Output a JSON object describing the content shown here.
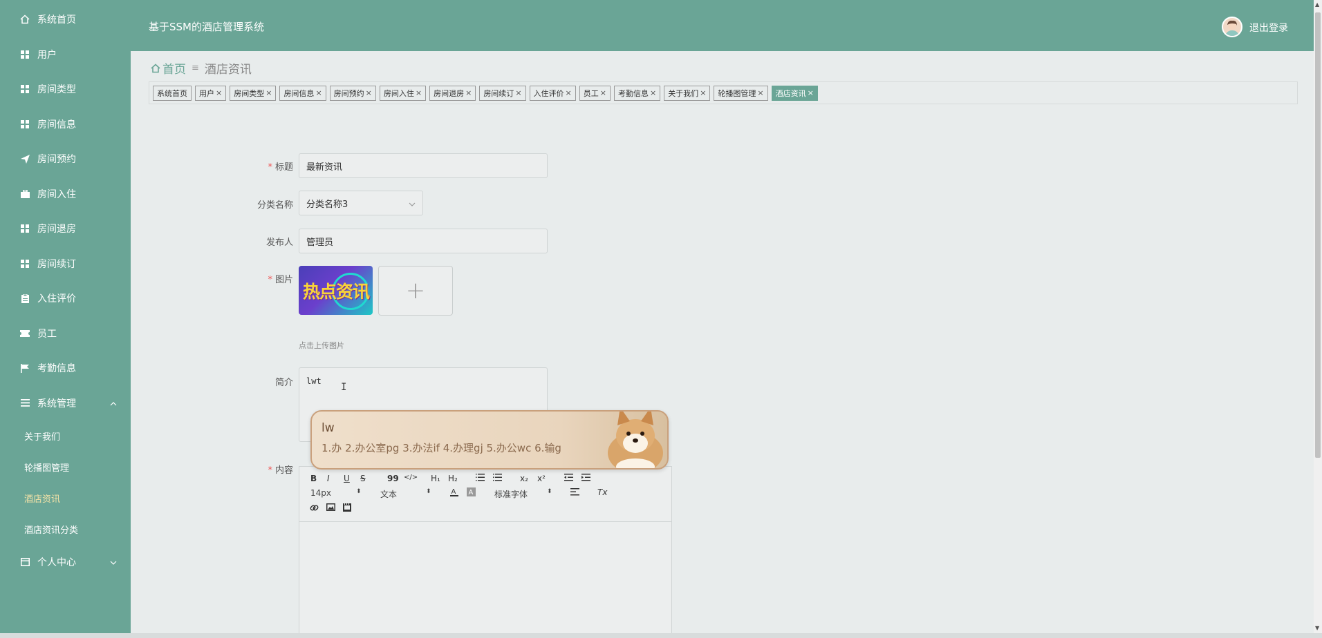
{
  "header": {
    "title": "基于SSM的酒店管理系统",
    "logout": "退出登录"
  },
  "sidebar": {
    "items": [
      {
        "label": "系统首页",
        "icon": "home-icon"
      },
      {
        "label": "用户",
        "icon": "grid-icon"
      },
      {
        "label": "房间类型",
        "icon": "grid-icon"
      },
      {
        "label": "房间信息",
        "icon": "grid-icon"
      },
      {
        "label": "房间预约",
        "icon": "send-icon"
      },
      {
        "label": "房间入住",
        "icon": "briefcase-icon"
      },
      {
        "label": "房间退房",
        "icon": "grid-icon"
      },
      {
        "label": "房间续订",
        "icon": "grid-icon"
      },
      {
        "label": "入住评价",
        "icon": "clipboard-icon"
      },
      {
        "label": "员工",
        "icon": "ticket-icon"
      },
      {
        "label": "考勤信息",
        "icon": "flag-icon"
      },
      {
        "label": "系统管理",
        "icon": "list-icon"
      }
    ],
    "system_sub": [
      "关于我们",
      "轮播图管理",
      "酒店资讯",
      "酒店资讯分类"
    ],
    "personal": {
      "label": "个人中心",
      "icon": "calendar-icon"
    }
  },
  "breadcrumb": {
    "home": "首页",
    "current": "酒店资讯"
  },
  "tags": [
    {
      "label": "系统首页",
      "closable": false
    },
    {
      "label": "用户",
      "closable": true
    },
    {
      "label": "房间类型",
      "closable": true
    },
    {
      "label": "房间信息",
      "closable": true
    },
    {
      "label": "房间预约",
      "closable": true
    },
    {
      "label": "房间入住",
      "closable": true
    },
    {
      "label": "房间退房",
      "closable": true
    },
    {
      "label": "房间续订",
      "closable": true
    },
    {
      "label": "入住评价",
      "closable": true
    },
    {
      "label": "员工",
      "closable": true
    },
    {
      "label": "考勤信息",
      "closable": true
    },
    {
      "label": "关于我们",
      "closable": true
    },
    {
      "label": "轮播图管理",
      "closable": true
    },
    {
      "label": "酒店资讯",
      "closable": true,
      "active": true
    }
  ],
  "form": {
    "title_label": "标题",
    "title_value": "最新资讯",
    "category_label": "分类名称",
    "category_value": "分类名称3",
    "publisher_label": "发布人",
    "publisher_value": "管理员",
    "image_label": "图片",
    "image_text": "热点资讯",
    "upload_hint": "点击上传图片",
    "intro_label": "简介",
    "intro_value": "lwt",
    "content_label": "内容"
  },
  "ime": {
    "composition": "lw",
    "candidates": "1.办  2.办公室pg  3.办法if  4.办理gj  5.办公wc  6.输g"
  },
  "editor": {
    "font_size": "14px",
    "paragraph": "文本",
    "font_family": "标准字体",
    "buttons": {
      "bold": "B",
      "italic": "I",
      "underline": "U",
      "strike": "S",
      "quote": "99",
      "code": "</>",
      "h1": "H₁",
      "h2": "H₂",
      "sub": "x₂",
      "sup": "x²",
      "clear": "Tx"
    }
  },
  "required_mark": "*",
  "close_mark": "×",
  "plus_mark": "+",
  "colors": {
    "primary": "#6aa596",
    "active_sub": "#f3e2a7",
    "required": "#e55555"
  }
}
